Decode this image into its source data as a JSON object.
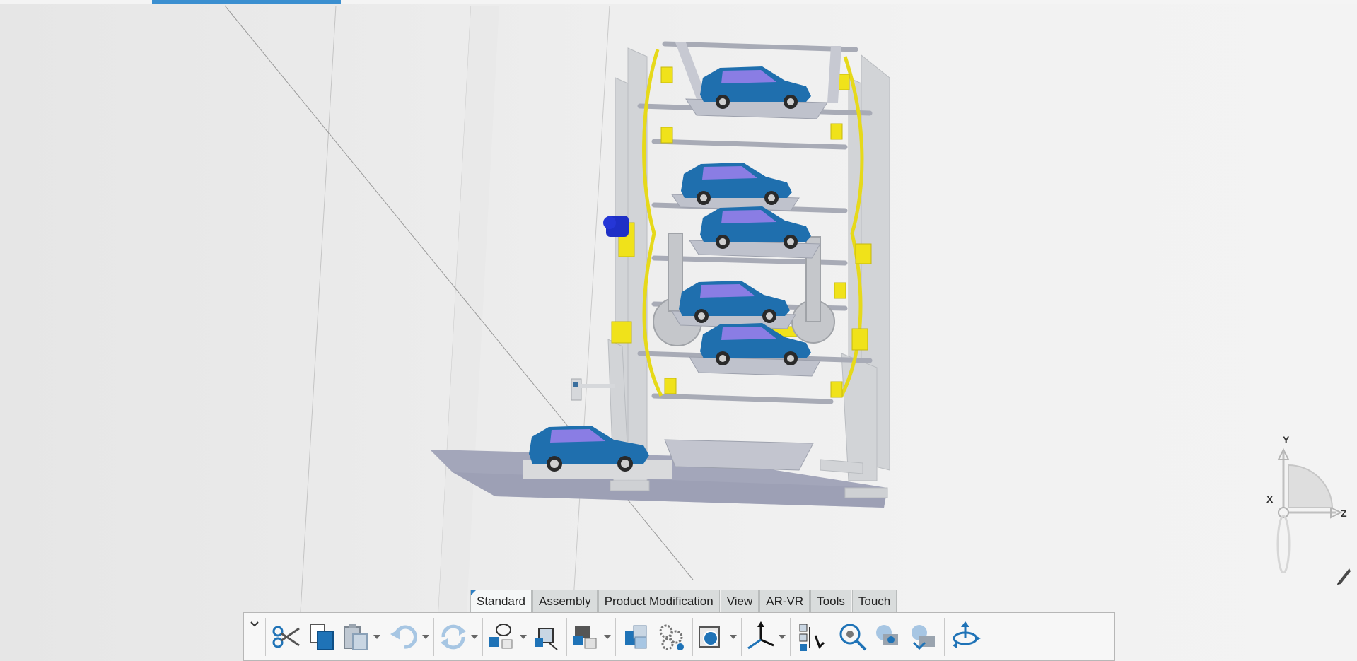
{
  "ribbon": {
    "tabs": [
      {
        "label": "Standard",
        "active": true
      },
      {
        "label": "Assembly",
        "active": false
      },
      {
        "label": "Product Modification",
        "active": false
      },
      {
        "label": "View",
        "active": false
      },
      {
        "label": "AR-VR",
        "active": false
      },
      {
        "label": "Tools",
        "active": false
      },
      {
        "label": "Touch",
        "active": false
      }
    ],
    "tools": [
      "cut-icon",
      "copy-icon",
      "paste-icon",
      "undo-icon",
      "update-icon",
      "insert-product-icon",
      "explode-icon",
      "assembly-components-icon",
      "constraints-icon",
      "mechanism-icon",
      "display-mode-icon",
      "compass-axis-icon",
      "tree-icon",
      "fly-zoom-icon",
      "hide-show-icon",
      "swap-visible-icon",
      "rotate-view-icon"
    ]
  },
  "triad": {
    "x_label": "X",
    "y_label": "Y",
    "z_label": "Z"
  },
  "colors": {
    "accent": "#3b8fd0",
    "car_body": "#1f6fae",
    "yellow_parts": "#f2e21b",
    "frame": "#cfd1d4",
    "motor": "#1d2fc4"
  }
}
